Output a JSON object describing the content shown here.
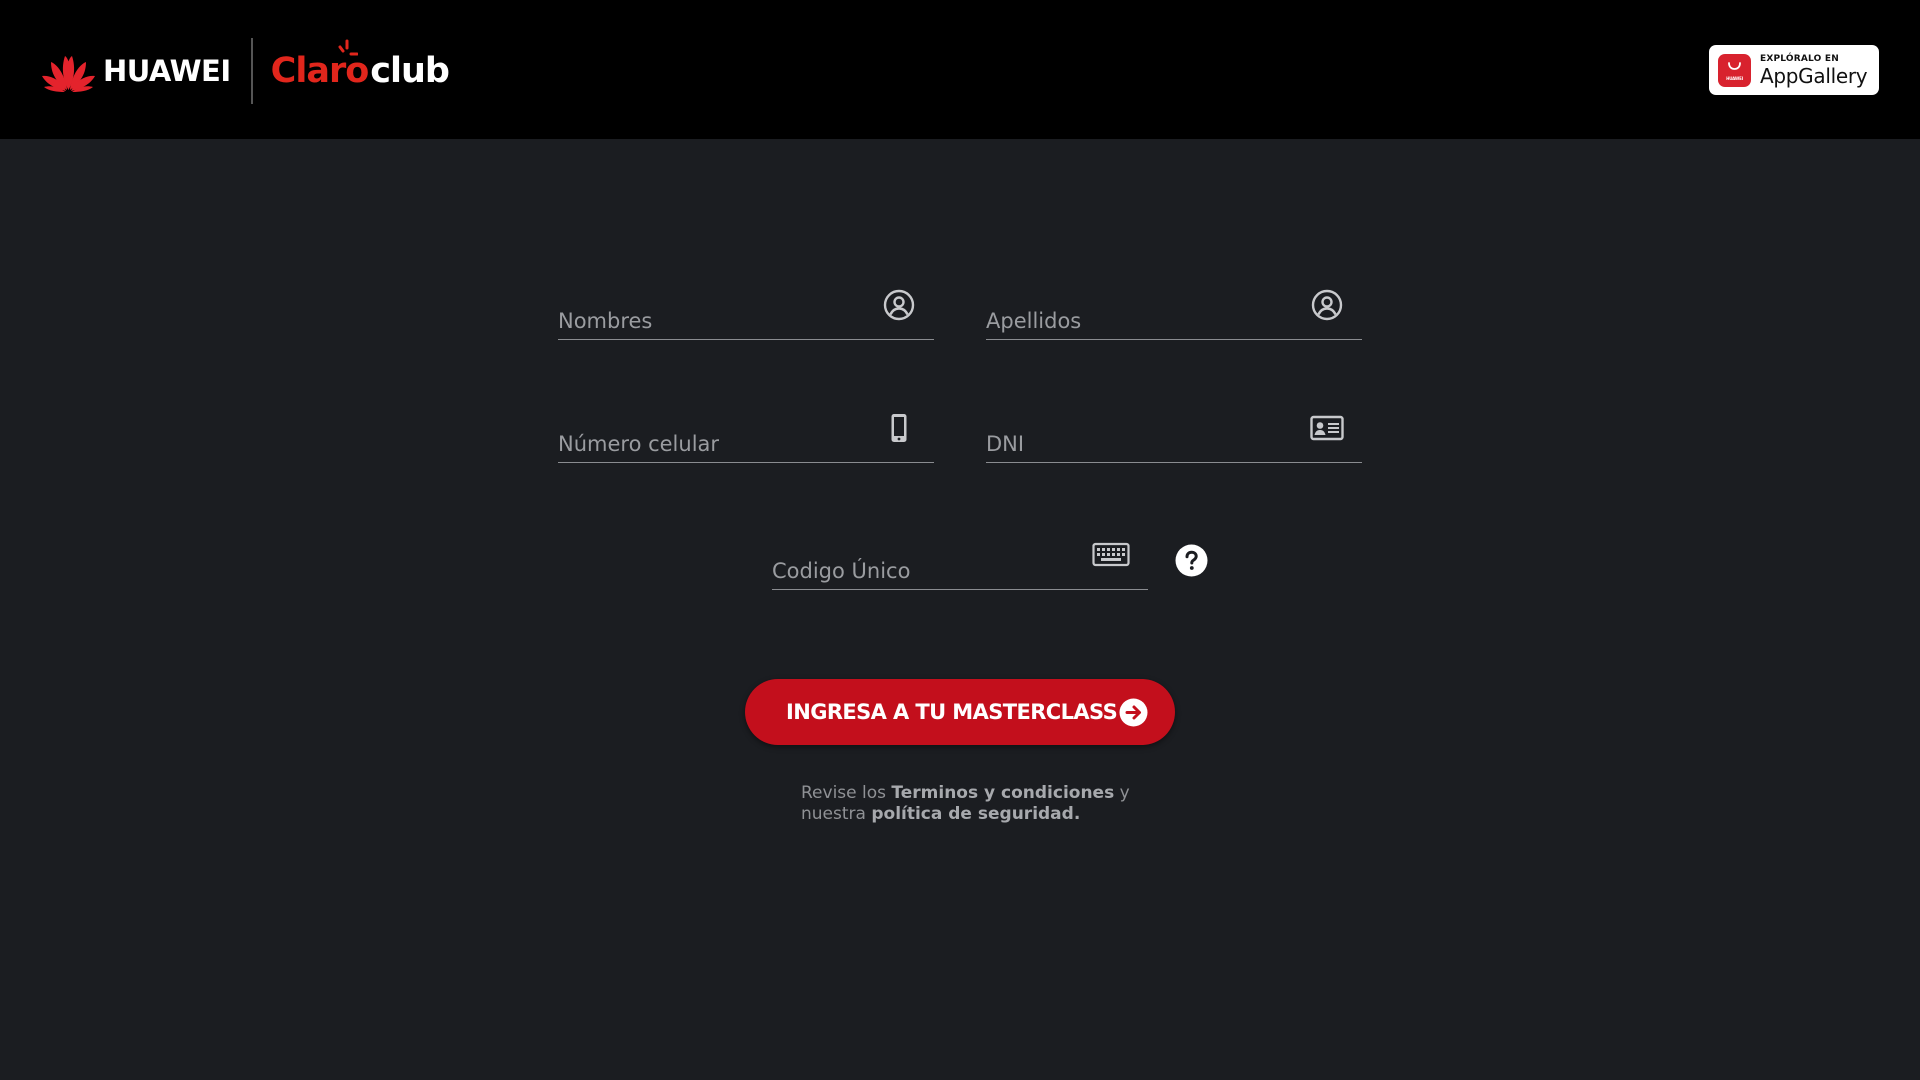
{
  "header": {
    "brand_huawei": "HUAWEI",
    "brand_claro": "Claro",
    "brand_club": "club",
    "appgallery": {
      "top_text": "EXPLÓRALO EN",
      "bottom_text": "AppGallery",
      "icon_text": "HUAWEI"
    }
  },
  "form": {
    "nombres": {
      "placeholder": "Nombres",
      "icon": "user-circle-icon"
    },
    "apellidos": {
      "placeholder": "Apellidos",
      "icon": "user-circle-icon"
    },
    "celular": {
      "placeholder": "Número celular",
      "icon": "mobile-phone-icon"
    },
    "dni": {
      "placeholder": "DNI",
      "icon": "id-card-icon"
    },
    "codigo": {
      "placeholder": "Codigo Único",
      "icon": "keyboard-icon",
      "help_icon": "question-circle-icon"
    }
  },
  "cta": {
    "label": "INGRESA A TU MASTERCLASS",
    "icon": "arrow-right-circle-icon"
  },
  "legal": {
    "prefix": "Revise los ",
    "terms_link": "Terminos y condiciones",
    "middle": " y nuestra ",
    "privacy_link": "política de seguridad."
  },
  "colors": {
    "header_bg": "#000000",
    "page_bg": "#1b1d21",
    "accent_red": "#c30f1c",
    "claro_red": "#e1261c"
  }
}
